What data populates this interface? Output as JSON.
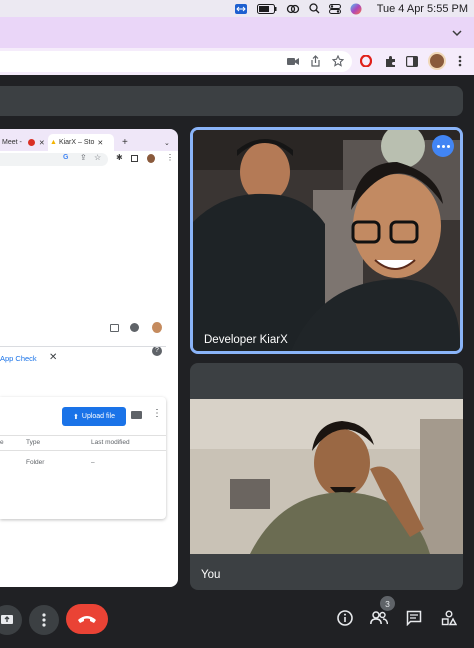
{
  "menubar": {
    "datetime": "Tue 4 Apr  5:55 PM",
    "icons": [
      "teamviewer-icon",
      "battery-icon",
      "link-icon",
      "search-icon",
      "control-center-icon",
      "siri-icon"
    ]
  },
  "browser": {
    "toolbar_icons": [
      "camera-icon",
      "share-icon",
      "bookmark-star-icon",
      "opera-icon",
      "extensions-icon",
      "sidepanel-icon",
      "profile-avatar",
      "menu-icon"
    ]
  },
  "presentation": {
    "tabs": [
      "Meet -",
      "KiarX – Sto"
    ],
    "app_check_label": "App Check",
    "upload_button_label": "Upload file",
    "columns": [
      "e",
      "Type",
      "Last modified"
    ],
    "rows": [
      {
        "name": "",
        "type": "Folder",
        "modified": "–"
      }
    ]
  },
  "participants": [
    {
      "name": "Developer KiarX",
      "active_speaker": true
    },
    {
      "name": "You",
      "active_speaker": false
    }
  ],
  "controls": {
    "participant_count": "3",
    "accent_colors": {
      "hangup": "#ea4335",
      "active_border": "#8ab4f8",
      "upload": "#1a73e8"
    }
  }
}
